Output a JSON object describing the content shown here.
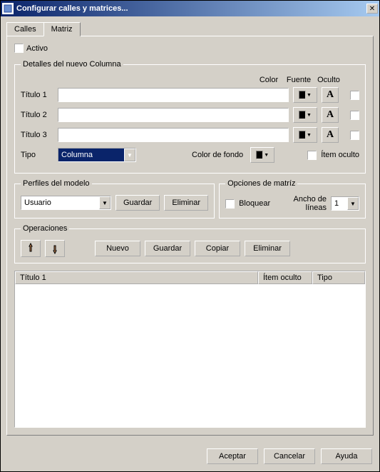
{
  "window": {
    "title": "Configurar calles y matrices..."
  },
  "tabs": {
    "calles": "Calles",
    "matriz": "Matriz"
  },
  "activo": {
    "label": "Activo",
    "checked": false
  },
  "detalles": {
    "legend": "Detalles del nuevo Columna",
    "headers": {
      "color": "Color",
      "fuente": "Fuente",
      "oculto": "Oculto"
    },
    "titulo1": {
      "label": "Título 1",
      "value": ""
    },
    "titulo2": {
      "label": "Título 2",
      "value": ""
    },
    "titulo3": {
      "label": "Título 3",
      "value": ""
    },
    "tipo": {
      "label": "Tipo",
      "value": "Columna"
    },
    "colorFondo": {
      "label": "Color de fondo"
    },
    "itemOculto": {
      "label": "Ítem oculto",
      "checked": false
    },
    "fontGlyph": "A",
    "colors": {
      "c1": "#000000",
      "c2": "#000000",
      "c3": "#000000",
      "fondo": "#000000"
    }
  },
  "perfiles": {
    "legend": "Perfiles del modelo",
    "value": "Usuario",
    "guardar": "Guardar",
    "eliminar": "Eliminar"
  },
  "opciones": {
    "legend": "Opciones de matríz",
    "bloquear": {
      "label": "Bloquear",
      "checked": false
    },
    "ancho": {
      "label": "Ancho de líneas",
      "value": "1"
    }
  },
  "operaciones": {
    "legend": "Operaciones",
    "nuevo": "Nuevo",
    "guardar": "Guardar",
    "copiar": "Copiar",
    "eliminar": "Eliminar"
  },
  "list": {
    "colTitulo": "Título 1",
    "colItemOculto": "Ítem oculto",
    "colTipo": "Tipo"
  },
  "dialog": {
    "aceptar": "Aceptar",
    "cancelar": "Cancelar",
    "ayuda": "Ayuda"
  }
}
